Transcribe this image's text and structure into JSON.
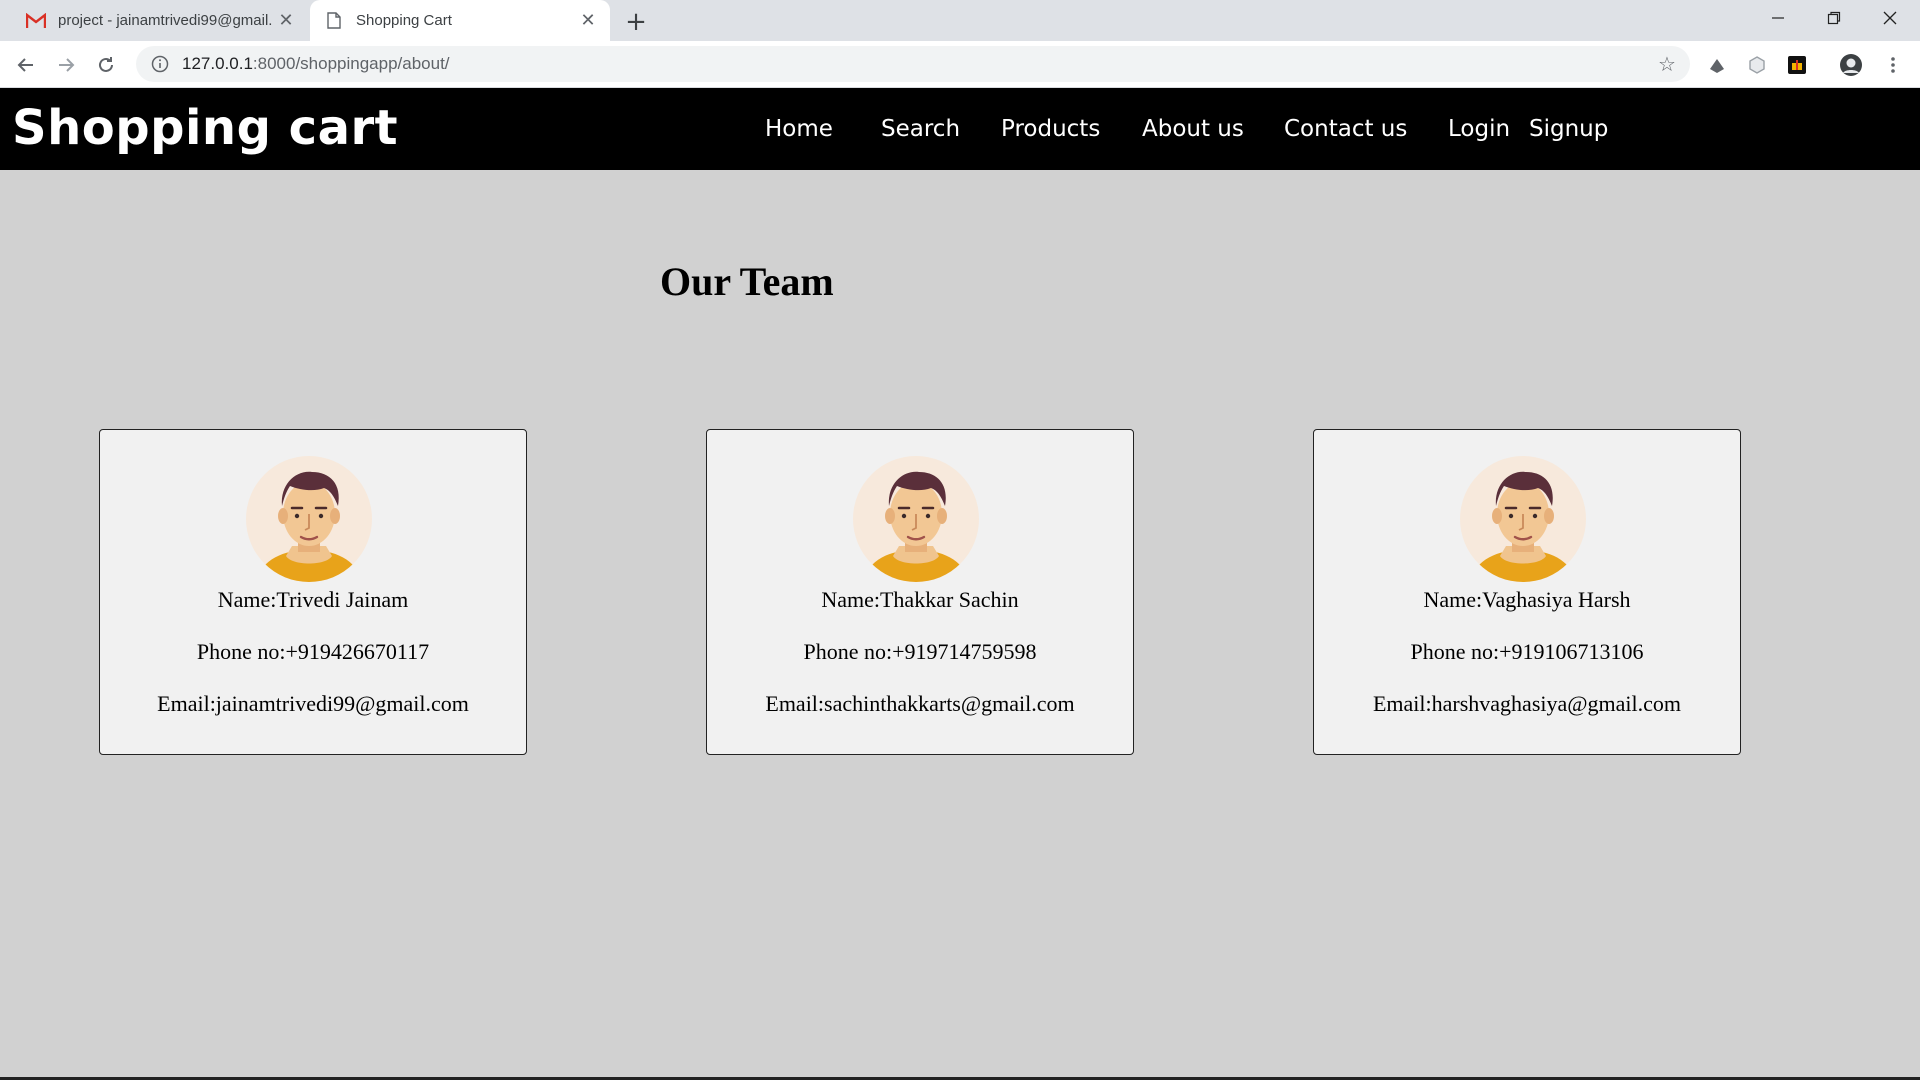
{
  "browser": {
    "tabs": [
      {
        "title": "project - jainamtrivedi99@gmail.",
        "favicon": "gmail-icon",
        "active": false
      },
      {
        "title": "Shopping Cart",
        "favicon": "page-icon",
        "active": true
      }
    ],
    "url_host": "127.0.0.1",
    "url_path": ":8000/shoppingapp/about/"
  },
  "site": {
    "brand": "Shopping cart",
    "nav": [
      "Home",
      "Search",
      "Products",
      "About us",
      "Contact us",
      "Login",
      "Signup"
    ]
  },
  "page": {
    "title": "Our Team"
  },
  "team": [
    {
      "name": "Name:Trivedi Jainam",
      "phone": "Phone no:+919426670117",
      "email": "Email:jainamtrivedi99@gmail.com"
    },
    {
      "name": "Name:Thakkar Sachin",
      "phone": "Phone no:+919714759598",
      "email": "Email:sachinthakkarts@gmail.com"
    },
    {
      "name": "Name:Vaghasiya Harsh",
      "phone": "Phone no:+919106713106",
      "email": "Email:harshvaghasiya@gmail.com"
    }
  ],
  "colors": {
    "header_bg": "#000000",
    "page_bg": "#d1d1d1",
    "card_bg": "#f1f1f1"
  }
}
